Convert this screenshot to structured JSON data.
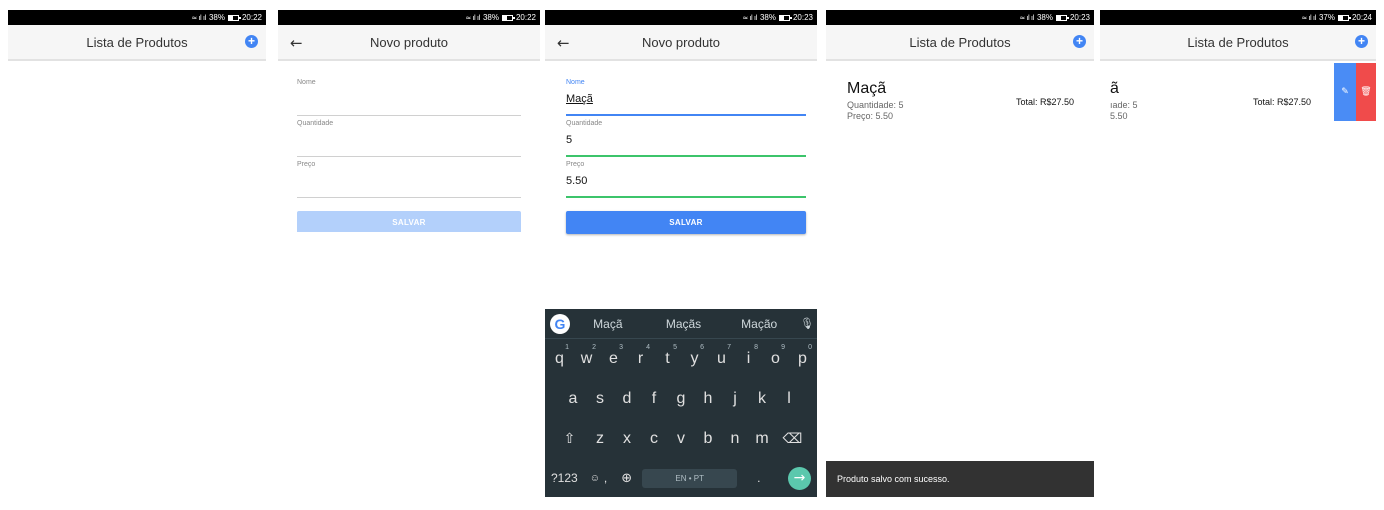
{
  "screens": [
    {
      "status": {
        "battery": "38%",
        "time": "20:22"
      },
      "appbar": {
        "title": "Lista de Produtos"
      }
    },
    {
      "status": {
        "battery": "38%",
        "time": "20:22"
      },
      "appbar": {
        "title": "Novo produto"
      },
      "form": {
        "fields": [
          {
            "label": "Nome",
            "value": ""
          },
          {
            "label": "Quantidade",
            "value": ""
          },
          {
            "label": "Preço",
            "value": ""
          }
        ],
        "save_label": "SALVAR"
      }
    },
    {
      "status": {
        "battery": "38%",
        "time": "20:23"
      },
      "appbar": {
        "title": "Novo produto"
      },
      "form": {
        "fields": [
          {
            "label": "Nome",
            "value": "Maçã"
          },
          {
            "label": "Quantidade",
            "value": "5"
          },
          {
            "label": "Preço",
            "value": "5.50"
          }
        ],
        "save_label": "SALVAR"
      },
      "keyboard": {
        "suggestions": [
          "Maçã",
          "Maçãs",
          "Mação"
        ],
        "row1": [
          "q",
          "w",
          "e",
          "r",
          "t",
          "y",
          "u",
          "i",
          "o",
          "p"
        ],
        "row1_hints": [
          "1",
          "2",
          "3",
          "4",
          "5",
          "6",
          "7",
          "8",
          "9",
          "0"
        ],
        "row2": [
          "a",
          "s",
          "d",
          "f",
          "g",
          "h",
          "j",
          "k",
          "l"
        ],
        "row3": [
          "z",
          "x",
          "c",
          "v",
          "b",
          "n",
          "m"
        ],
        "symbols_label": "?123",
        "emoji_label": "☺",
        "comma_label": ",",
        "space_label": "EN • PT",
        "period_label": "."
      }
    },
    {
      "status": {
        "battery": "38%",
        "time": "20:23"
      },
      "appbar": {
        "title": "Lista de Produtos"
      },
      "item": {
        "name": "Maçã",
        "quantity": "Quantidade: 5",
        "price": "Preço: 5.50",
        "total": "Total: R$27.50"
      },
      "snackbar": "Produto salvo com sucesso."
    },
    {
      "status": {
        "battery": "37%",
        "time": "20:24"
      },
      "appbar": {
        "title": "Lista de Produtos"
      },
      "item": {
        "name_partial": "ã",
        "quantity_partial": "ıade: 5",
        "price_partial": "5.50",
        "total": "Total: R$27.50"
      }
    }
  ],
  "colors": {
    "primary": "#4285f4",
    "valid": "#3cc46b",
    "delete": "#f04b4b",
    "keyboard": "#263238"
  }
}
